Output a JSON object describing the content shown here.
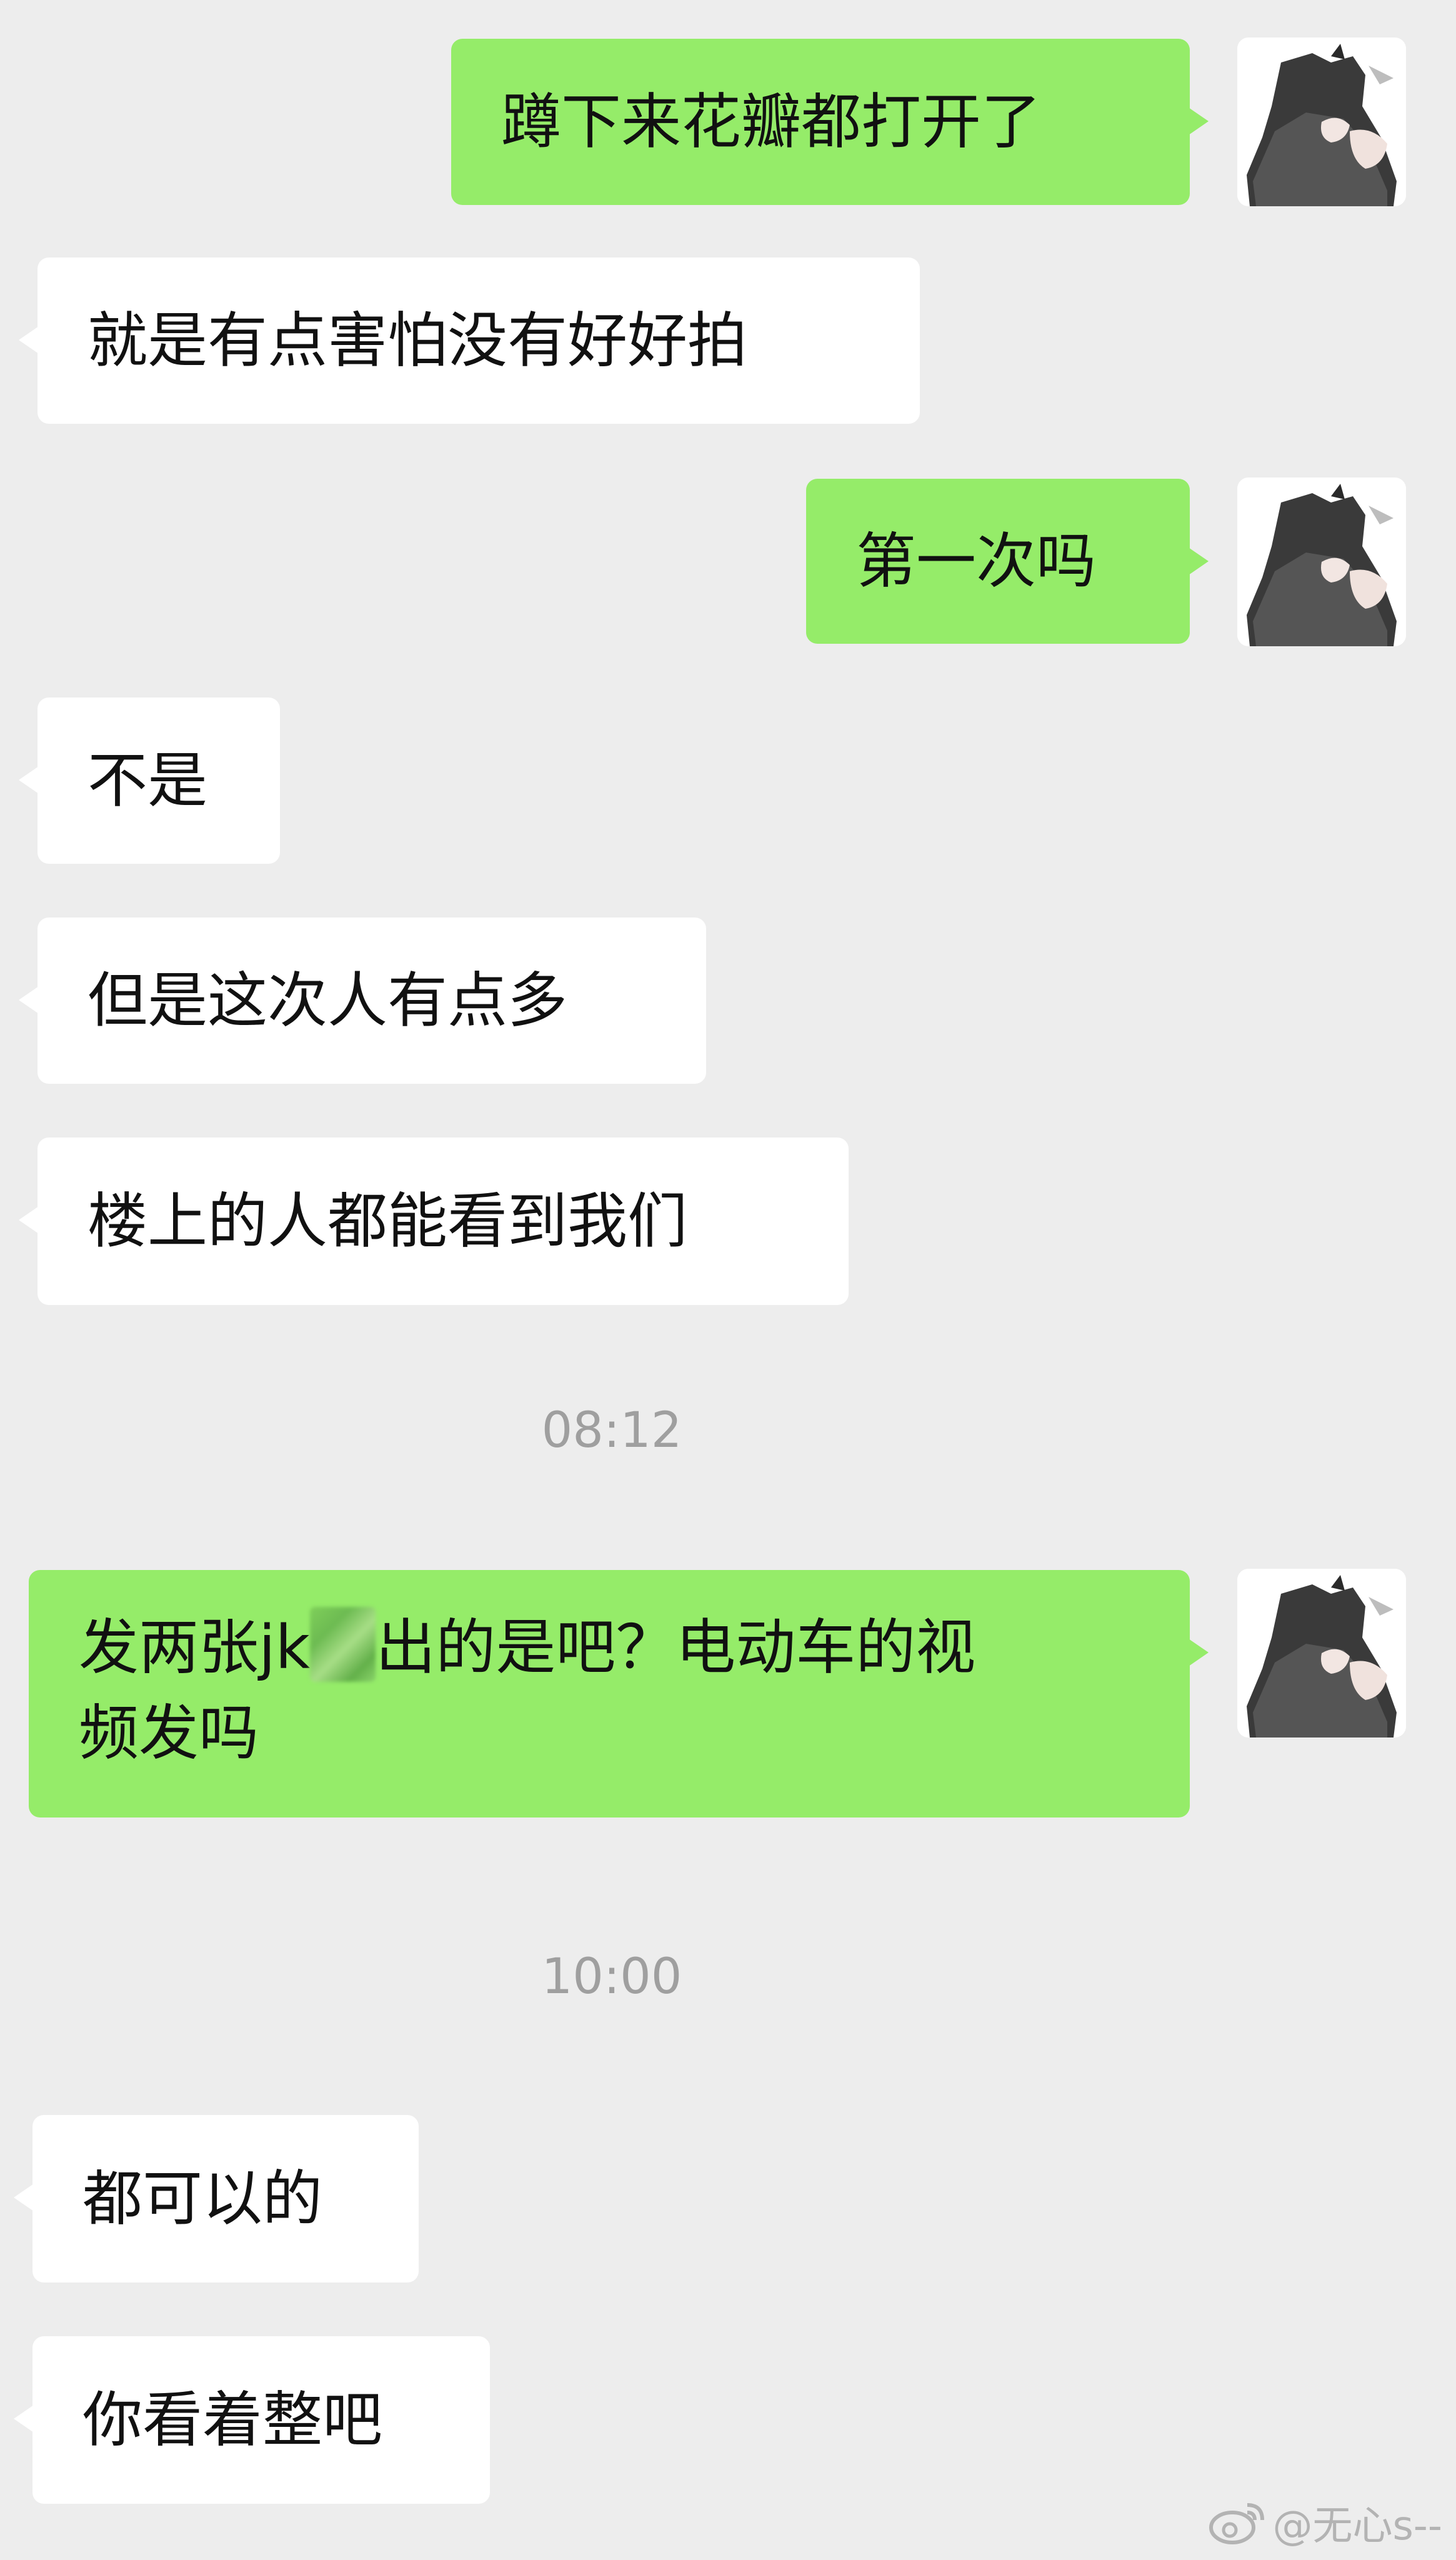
{
  "messages": [
    {
      "side": "out",
      "text": "蹲下来花瓣都打开了"
    },
    {
      "side": "in",
      "text": "就是有点害怕没有好好拍"
    },
    {
      "side": "out",
      "text": "第一次吗"
    },
    {
      "side": "in",
      "text": "不是"
    },
    {
      "side": "in",
      "text": "但是这次人有点多"
    },
    {
      "side": "in",
      "text": "楼上的人都能看到我们"
    },
    {
      "timestamp": "08:12"
    },
    {
      "side": "out",
      "text_before": "发两张jk",
      "text_after": "出的是吧？电动车的视",
      "text_line2": "频发吗"
    },
    {
      "timestamp": "10:00"
    },
    {
      "side": "in",
      "text": "都可以的"
    },
    {
      "side": "in",
      "text": "你看着整吧"
    }
  ],
  "watermark": "@无心s--",
  "icons": {
    "avatar": "anime-character-avatar",
    "watermark": "weibo-logo-icon"
  },
  "colors": {
    "background": "#ededed",
    "incoming_bubble": "#ffffff",
    "outgoing_bubble": "#95ec69",
    "timestamp": "#9f9f9f"
  }
}
